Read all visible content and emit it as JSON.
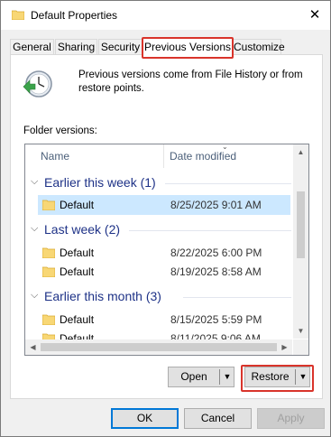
{
  "window": {
    "title": "Default Properties",
    "close_glyph": "✕"
  },
  "tabs": [
    {
      "label": "General"
    },
    {
      "label": "Sharing"
    },
    {
      "label": "Security"
    },
    {
      "label": "Previous Versions"
    },
    {
      "label": "Customize"
    }
  ],
  "active_tab": "Previous Versions",
  "description": "Previous versions come from File History or from restore points.",
  "folder_versions_label": "Folder versions:",
  "columns": {
    "name": "Name",
    "date_modified": "Date modified"
  },
  "groups": [
    {
      "title": "Earlier this week (1)",
      "items": [
        {
          "name": "Default",
          "date": "8/25/2025 9:01 AM",
          "selected": true
        }
      ]
    },
    {
      "title": "Last week (2)",
      "items": [
        {
          "name": "Default",
          "date": "8/22/2025 6:00 PM"
        },
        {
          "name": "Default",
          "date": "8/19/2025 8:58 AM"
        }
      ]
    },
    {
      "title": "Earlier this month (3)",
      "items": [
        {
          "name": "Default",
          "date": "8/15/2025 5:59 PM"
        },
        {
          "name": "Default",
          "date": "8/11/2025 9:06 AM"
        }
      ]
    }
  ],
  "buttons": {
    "open": "Open",
    "restore": "Restore",
    "ok": "OK",
    "cancel": "Cancel",
    "apply": "Apply"
  },
  "colors": {
    "highlight_border": "#d9342b",
    "selection": "#cce8ff",
    "group_header": "#1e3287",
    "folder": "#f8d775"
  }
}
